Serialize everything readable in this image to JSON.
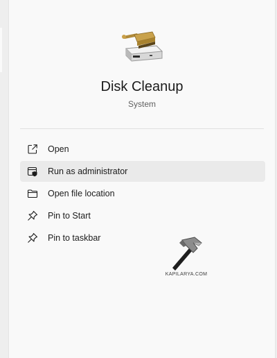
{
  "app": {
    "name": "Disk Cleanup",
    "category": "System",
    "icon": "disk-cleanup-icon"
  },
  "menu": [
    {
      "label": "Open",
      "icon": "open-external-icon"
    },
    {
      "label": "Run as administrator",
      "icon": "admin-shield-icon",
      "hovered": true
    },
    {
      "label": "Open file location",
      "icon": "folder-icon"
    },
    {
      "label": "Pin to Start",
      "icon": "pin-icon"
    },
    {
      "label": "Pin to taskbar",
      "icon": "pin-icon"
    }
  ],
  "watermark": {
    "text": "KAPILARYA.COM",
    "icon": "hammer-icon"
  },
  "colors": {
    "panel_bg": "#f9f9f9",
    "hover_bg": "#eaeaea",
    "text": "#1b1b1b",
    "subtext": "#5f5f5f"
  }
}
